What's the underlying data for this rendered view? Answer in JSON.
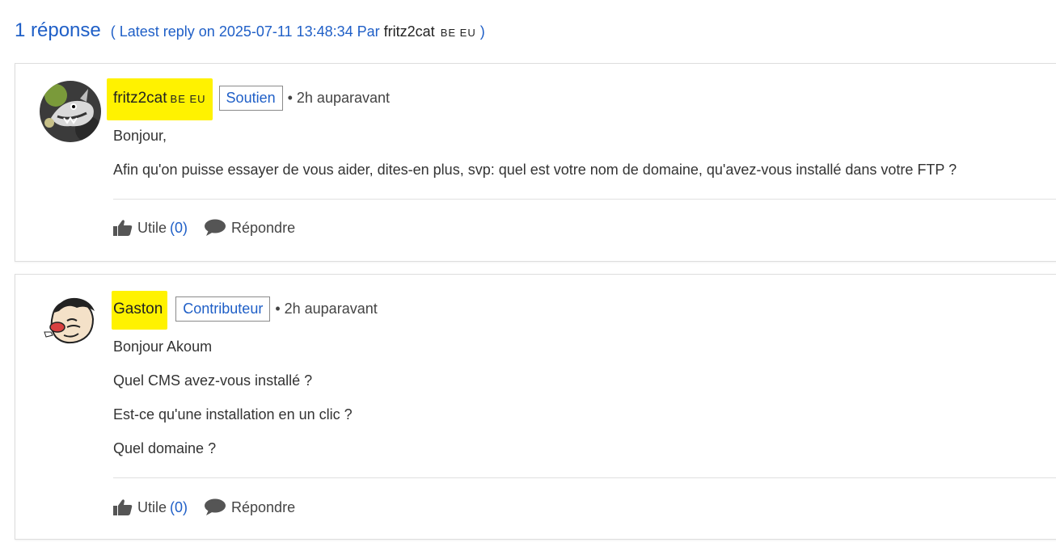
{
  "header": {
    "reply_count": "1 réponse",
    "latest_prefix": "( Latest reply on 2025-07-11 13:48:34 Par",
    "latest_author": "fritz2cat",
    "latest_country": "BE EU",
    "latest_suffix": ")"
  },
  "posts": [
    {
      "username": "fritz2cat",
      "country": "BE EU",
      "role": "Soutien",
      "time": "• 2h auparavant",
      "paragraphs": [
        "Bonjour,",
        "Afin qu'on puisse essayer de vous aider, dites-en plus, svp: quel est votre nom de domaine, qu'avez-vous installé dans votre FTP ?"
      ],
      "useful_label": "Utile",
      "useful_count": "(0)",
      "reply_label": "Répondre"
    },
    {
      "username": "Gaston",
      "country": "",
      "role": "Contributeur",
      "time": "• 2h auparavant",
      "paragraphs": [
        "Bonjour Akoum",
        "Quel CMS avez-vous installé ?",
        "Est-ce qu'une installation en un clic ?",
        "Quel domaine ?"
      ],
      "useful_label": "Utile",
      "useful_count": "(0)",
      "reply_label": "Répondre"
    }
  ],
  "colors": {
    "link": "#1f5fc7",
    "highlight": "#fff200",
    "text": "#333333"
  },
  "icons": [
    "thumbs-up-icon",
    "speech-bubble-icon"
  ]
}
